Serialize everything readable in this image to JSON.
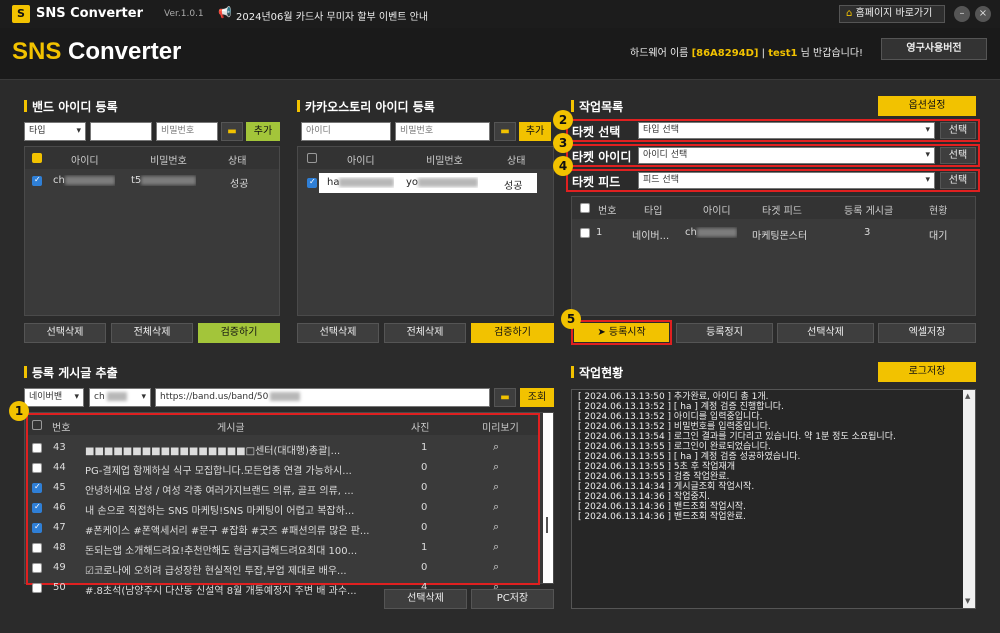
{
  "app": {
    "name": "SNS Converter",
    "version": "Ver.1.0.1",
    "notice": "2024년06월 카드사 무미자 할부 이벤트 안내",
    "homepage_btn": "홈페이지 바로가기",
    "logo_a": "SNS",
    "logo_b": " Converter",
    "hw_prefix": "하드웨어 이름 ",
    "hw_id": "[86A8294D]",
    "sep": " | ",
    "user": "test1",
    "greet": " 님 반갑습니다!",
    "license_btn": "영구사용버전",
    "accent": "#f2c200"
  },
  "band": {
    "title": "밴드 아이디 등록",
    "type_sel": "타입",
    "pw_placeholder": "비밀번호",
    "add": "추가",
    "cols": [
      "아이디",
      "비밀번호",
      "상태"
    ],
    "rows": [
      {
        "id": "ch",
        "pw": "t5",
        "status": "성공"
      }
    ],
    "btn_del_sel": "선택삭제",
    "btn_del_all": "전체삭제",
    "btn_verify": "검증하기"
  },
  "kakao": {
    "title": "카카오스토리 아이디 등록",
    "id_placeholder": "아이디",
    "pw_placeholder": "비밀번호",
    "add": "추가",
    "cols": [
      "아이디",
      "비밀번호",
      "상태"
    ],
    "rows": [
      {
        "id": "ha",
        "pw": "yo",
        "status": "성공"
      }
    ],
    "btn_del_sel": "선택삭제",
    "btn_del_all": "전체삭제",
    "btn_verify": "검증하기"
  },
  "jobs": {
    "title": "작업목록",
    "options": "옵션설정",
    "target_sel_label": "타켓 선택",
    "target_sel_value": "타입 선택",
    "target_id_label": "타켓 아이디",
    "target_id_value": "아이디 선택",
    "target_feed_label": "타켓 피드",
    "target_feed_value": "피드 선택",
    "pick": "선택",
    "cols": [
      "번호",
      "타입",
      "아이디",
      "타겟 피드",
      "등록 게시글",
      "현황"
    ],
    "rows": [
      {
        "no": "1",
        "type": "네이버...",
        "id": "ch",
        "feed": "마케팅몬스터",
        "count": "3",
        "status": "대기"
      }
    ],
    "start": "등록시작",
    "stop": "등록정지",
    "del_sel": "선택삭제",
    "excel": "엑셀저장"
  },
  "extract": {
    "title": "등록 게시글 추출",
    "source": "네이버밴",
    "account": "ch",
    "url": "https://band.us/band/50",
    "search": "조회",
    "cols": [
      "번호",
      "게시글",
      "사진",
      "미리보기"
    ],
    "rows": [
      {
        "no": "43",
        "text": "■■■■■■■■■■■■■■■■■□센터(대대행)총괄|...",
        "photo": "1",
        "checked": false
      },
      {
        "no": "44",
        "text": "PG-결제업 함께하실 식구 모집합니다.모든업종 연결 가능하시...",
        "photo": "0",
        "checked": false
      },
      {
        "no": "45",
        "text": "안녕하세요 남성 / 여성 각종 여러가지브랜드 의류, 골프 의류, ...",
        "photo": "0",
        "checked": true
      },
      {
        "no": "46",
        "text": "내 손으로 직접하는 SNS 마케팅!SNS 마케팅이 어렵고 복잡하...",
        "photo": "0",
        "checked": true
      },
      {
        "no": "47",
        "text": "#폰케이스 #폰액세서리 #문구 #잡화 #굿즈 #패션의류 많은 판...",
        "photo": "0",
        "checked": true
      },
      {
        "no": "48",
        "text": "돈되는앱 소개해드려요!추천만해도 현금지급해드려요최대 100...",
        "photo": "1",
        "checked": false
      },
      {
        "no": "49",
        "text": "☑코로나에 오히려 급성장한 현실적인 투잡,부업 제대로 배우...",
        "photo": "0",
        "checked": false
      },
      {
        "no": "50",
        "text": "#.8초석(남양주시 다산동 신설역 8월 개통예정지 주변 배 과수...",
        "photo": "4",
        "checked": false
      }
    ],
    "del_sel": "선택삭제",
    "pc_save": "PC저장"
  },
  "status": {
    "title": "작업현황",
    "log_save": "로그저장",
    "lines": [
      "[ 2024.06.13.13:50 ] 추가완료, 아이디 총 1개.",
      "[ 2024.06.13.13:52 ] [ ha                    ] 계정 검증 진행합니다.",
      "[ 2024.06.13.13:52 ] 아이디를 입력중입니다.",
      "[ 2024.06.13.13:52 ] 비밀번호를 입력중입니다.",
      "[ 2024.06.13.13:54 ] 로그인 결과를 기다리고 있습니다. 약 1분 정도 소요됩니다.",
      "[ 2024.06.13.13:55 ] 로그인이 완료되었습니다.",
      "[ 2024.06.13.13:55 ] [ ha                    ] 계정 검증 성공하였습니다.",
      "[ 2024.06.13.13:55 ] 5초 후 작업재개",
      "[ 2024.06.13.13:55 ] 검증 작업완료.",
      "[ 2024.06.13.14:34 ] 게시글조회 작업시작.",
      "[ 2024.06.13.14:36 ] 작업중지.",
      "[ 2024.06.13.14:36 ] 밴드조회 작업시작.",
      "[ 2024.06.13.14:36 ] 밴드조회 작업완료."
    ]
  },
  "badges": [
    "1",
    "2",
    "3",
    "4",
    "5"
  ]
}
